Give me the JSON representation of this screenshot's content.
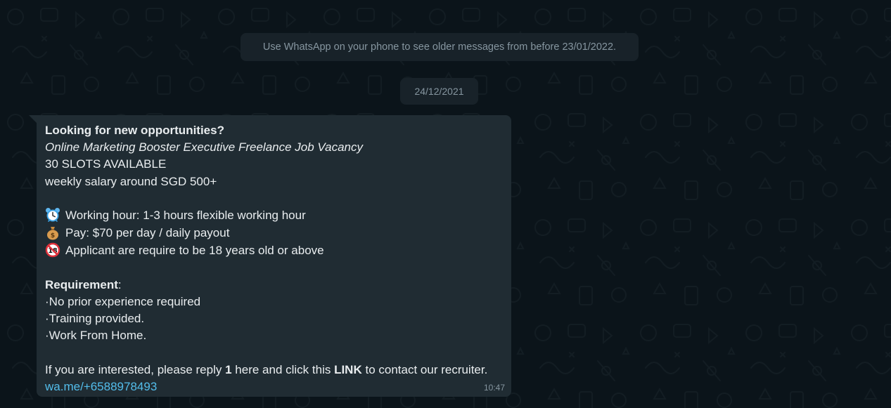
{
  "notice": "Use WhatsApp on your phone to see older messages from before 23/01/2022.",
  "date": "24/12/2021",
  "message": {
    "heading": "Looking for new opportunities?",
    "job_title": "Online Marketing Booster Executive Freelance Job Vacancy",
    "slots": "30 SLOTS AVAILABLE",
    "salary": "weekly salary around SGD 500+",
    "details": [
      {
        "icon": "alarm-clock-icon",
        "text": "Working hour: 1-3 hours flexible working hour"
      },
      {
        "icon": "money-bag-icon",
        "text": "Pay: $70 per day / daily payout"
      },
      {
        "icon": "no-under-18-icon",
        "text": "Applicant are require to be 18 years old or above"
      }
    ],
    "requirement_label": "Requirement",
    "requirement_colon": ":",
    "requirements": [
      "·No prior experience required",
      "·Training provided.",
      "·Work From Home."
    ],
    "cta": {
      "before": "If you are interested, please reply ",
      "reply_value": "1",
      "middle": " here and click this ",
      "link_word": "LINK",
      "after": " to contact our recruiter."
    },
    "link": "wa.me/+6588978493",
    "time": "10:47"
  },
  "colors": {
    "background": "#0b141a",
    "bubble": "#202c33",
    "pill": "#182229",
    "muted_text": "#8696a0",
    "link": "#53bdeb"
  }
}
